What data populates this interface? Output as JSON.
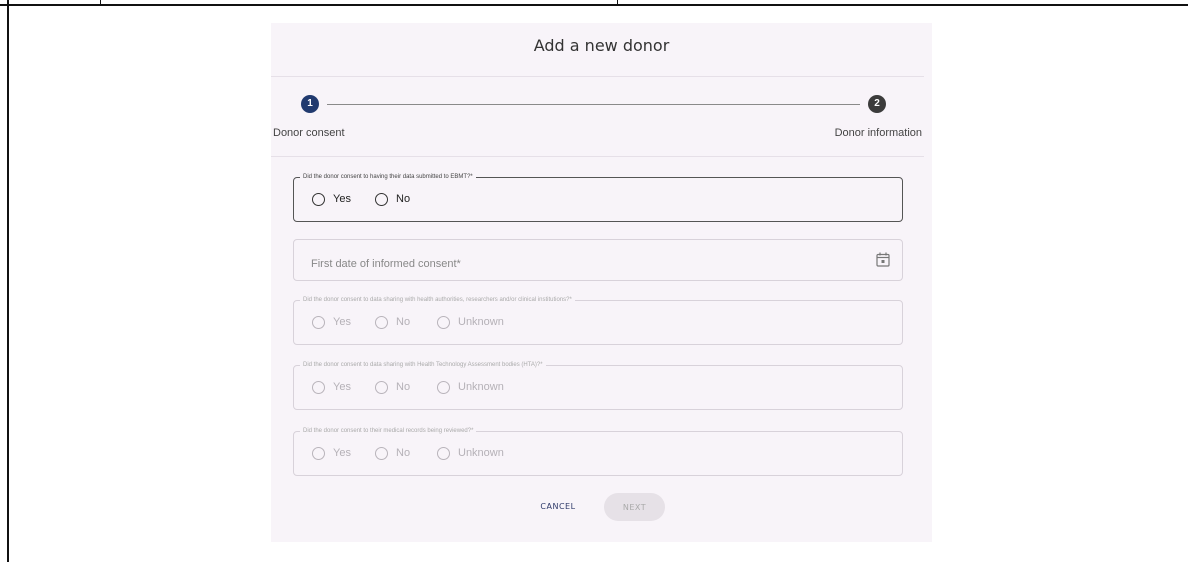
{
  "dialog": {
    "title": "Add a new donor",
    "stepper": {
      "steps": [
        {
          "number": "1",
          "label": "Donor consent"
        },
        {
          "number": "2",
          "label": "Donor information"
        }
      ]
    },
    "questions": [
      {
        "label": "Did the donor consent to having their data submitted to EBMT?*",
        "options": [
          "Yes",
          "No"
        ]
      },
      {
        "label": "Did the donor consent to data sharing with health authorities, researchers and/or clinical institutions?*",
        "options": [
          "Yes",
          "No",
          "Unknown"
        ]
      },
      {
        "label": "Did the donor consent to data sharing with Health Technology Assessment bodies (HTA)?*",
        "options": [
          "Yes",
          "No",
          "Unknown"
        ]
      },
      {
        "label": "Did the donor consent to their medical records being reviewed?*",
        "options": [
          "Yes",
          "No",
          "Unknown"
        ]
      }
    ],
    "date_field": {
      "placeholder": "First date of informed consent*",
      "icon": "calendar-icon"
    },
    "buttons": {
      "cancel": "CANCEL",
      "next": "NEXT"
    }
  }
}
